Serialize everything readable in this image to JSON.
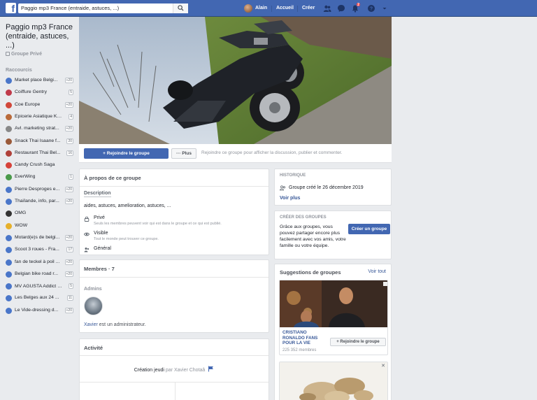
{
  "topbar": {
    "search_value": "Paggio mp3 France (entraide, astuces, ...)",
    "user_name": "Alain",
    "home_label": "Accueil",
    "create_label": "Créer",
    "notification_count": "2",
    "brand_color": "#4267b2"
  },
  "group": {
    "title": "Paggio mp3 France (entraide, astuces, ...)",
    "privacy": "Groupe Privé"
  },
  "shortcuts": {
    "heading": "Raccourcis",
    "items": [
      {
        "label": "Market place Belgi...",
        "count": "+20",
        "icon_color": "#4a76c9"
      },
      {
        "label": "Coiffure Gentry",
        "count": "5",
        "icon_color": "#c03a4a"
      },
      {
        "label": "Coe Europe",
        "count": "+20",
        "icon_color": "#d1473a"
      },
      {
        "label": "Epicerie Asiatique Ka...",
        "count": "4",
        "icon_color": "#b96a3a"
      },
      {
        "label": "Avl. marketing strat...",
        "count": "+20",
        "icon_color": "#888888"
      },
      {
        "label": "Snack Thai Isaane f...",
        "count": "20",
        "icon_color": "#9a5a3a"
      },
      {
        "label": "Restaurant Thai Bel...",
        "count": "16",
        "icon_color": "#b0413a"
      },
      {
        "label": "Candy Crush Saga",
        "count": "",
        "icon_color": "#d6423a"
      },
      {
        "label": "EverWing",
        "count": "1",
        "icon_color": "#4a9a4a"
      },
      {
        "label": "Pierre Desproges e...",
        "count": "+20",
        "icon_color": "#4a76c9"
      },
      {
        "label": "Thaïlande, info, par...",
        "count": "+20",
        "icon_color": "#4a76c9"
      },
      {
        "label": "OMG",
        "count": "",
        "icon_color": "#333333"
      },
      {
        "label": "WOW",
        "count": "",
        "icon_color": "#e6b02a"
      },
      {
        "label": "Motard(e)s de belgi...",
        "count": "+20",
        "icon_color": "#4a76c9"
      },
      {
        "label": "Scoot 3 roues - Fra...",
        "count": "17",
        "icon_color": "#4a76c9"
      },
      {
        "label": "fan de teckel à poil ...",
        "count": "+20",
        "icon_color": "#4a76c9"
      },
      {
        "label": "Belgian bike road r...",
        "count": "+20",
        "icon_color": "#4a76c9"
      },
      {
        "label": "MV AGUSTA Addict 🇮🇹",
        "count": "5",
        "icon_color": "#4a76c9"
      },
      {
        "label": "Les Belges aux 24 ...",
        "count": "11",
        "icon_color": "#4a76c9"
      },
      {
        "label": "Le Vide-dressing d...",
        "count": "+20",
        "icon_color": "#4a76c9"
      }
    ]
  },
  "actions": {
    "join_label": "+ Rejoindre le groupe",
    "more_label": "··· Plus",
    "join_hint": "Rejoindre ce groupe pour afficher la discussion, publier et commenter."
  },
  "about": {
    "title": "À propos de ce groupe",
    "description_label": "Description",
    "description": "aides, astuces, amelioration, astuces, ...",
    "private_title": "Privé",
    "private_sub": "Seuls les membres peuvent voir qui est dans le groupe et ce qui est publié.",
    "visible_title": "Visible",
    "visible_sub": "Tout le monde peut trouver ce groupe.",
    "category": "Général"
  },
  "members": {
    "title": "Membres · 7",
    "admins_label": "Admins",
    "admin_note": "Xavier est un administrateur.",
    "admin_name": "Xavier"
  },
  "activity": {
    "title": "Activité",
    "created_prefix": "Création",
    "created_day": "jeudi",
    "created_by": "par Xavier Chotaâ"
  },
  "history": {
    "heading": "HISTORIQUE",
    "text": "Groupe créé le 26 décembre 2019",
    "see_more": "Voir plus"
  },
  "create_groups": {
    "heading": "CRÉER DES GROUPES",
    "text": "Grâce aux groupes, vous pouvez partager encore plus facilement avec vos amis, votre famille ou votre équipe.",
    "button": "Créer un groupe"
  },
  "suggestions": {
    "title": "Suggestions de groupes",
    "see_all": "Voir tout",
    "items": [
      {
        "name": "CRISTIANO RONALDO FANS POUR LA VIE",
        "members": "225 352 membres",
        "join": "+ Rejoindre le groupe"
      }
    ]
  }
}
